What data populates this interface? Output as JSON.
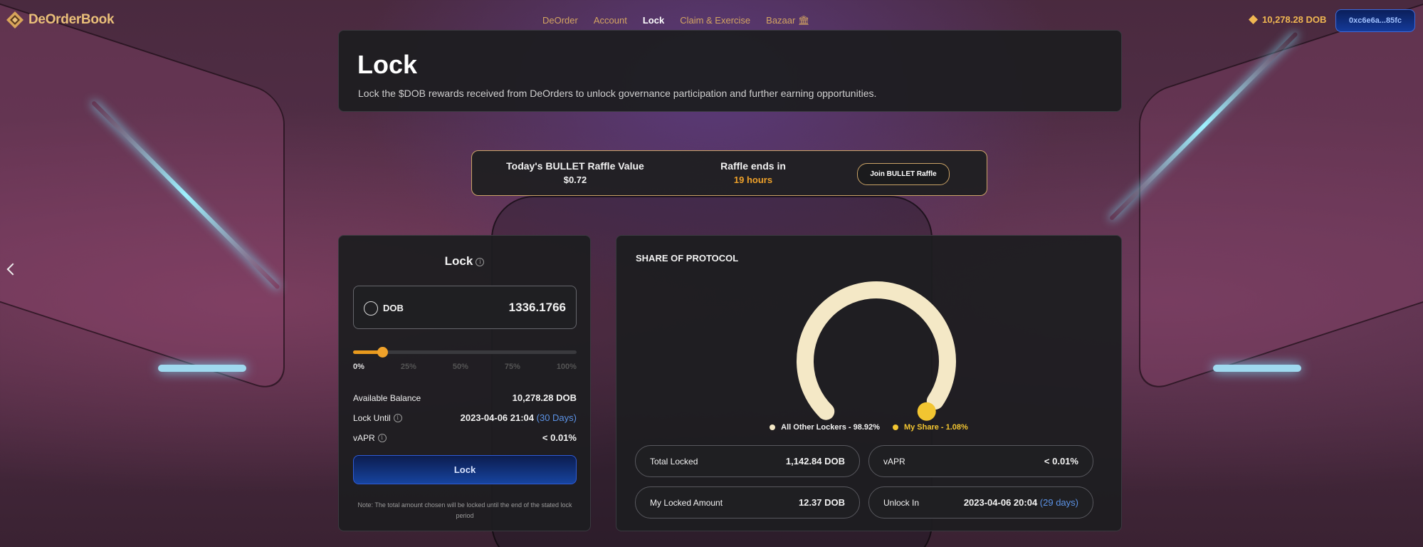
{
  "brand": {
    "name": "DeOrderBook"
  },
  "nav": {
    "items": [
      {
        "label": "DeOrder",
        "active": false
      },
      {
        "label": "Account",
        "active": false
      },
      {
        "label": "Lock",
        "active": true
      },
      {
        "label": "Claim & Exercise",
        "active": false
      },
      {
        "label": "Bazaar 🏛",
        "active": false
      }
    ]
  },
  "wallet": {
    "balance": "10,278.28 DOB",
    "address": "0xc6e6a...85fc"
  },
  "hero": {
    "title": "Lock",
    "subtitle": "Lock the $DOB rewards received from DeOrders to unlock governance participation and further earning opportunities."
  },
  "raffle": {
    "value_label": "Today's BULLET Raffle Value",
    "value": "$0.72",
    "ends_label": "Raffle ends in",
    "ends_value": "19 hours",
    "button": "Join BULLET Raffle"
  },
  "lock": {
    "title": "Lock",
    "token": "DOB",
    "amount": "1336.1766",
    "slider_percent": 13,
    "ticks": [
      "0%",
      "25%",
      "50%",
      "75%",
      "100%"
    ],
    "available_label": "Available Balance",
    "available_value": "10,278.28 DOB",
    "until_label": "Lock Until",
    "until_value": "2023-04-06 21:04",
    "until_days": "(30 Days)",
    "vapr_label": "vAPR",
    "vapr_value": "< 0.01%",
    "button": "Lock",
    "note": "Note: The total amount chosen will be locked until the end of the stated lock period"
  },
  "share": {
    "title": "SHARE OF PROTOCOL",
    "legend_other": "All Other Lockers - 98.92%",
    "legend_mine": "My Share - 1.08%",
    "other_pct": 98.92,
    "my_pct": 1.08,
    "colors": {
      "other": "#f4e8c6",
      "mine": "#f2c531"
    },
    "total_locked_label": "Total Locked",
    "total_locked_value": "1,142.84 DOB",
    "vapr_label": "vAPR",
    "vapr_value": "< 0.01%",
    "my_locked_label": "My Locked Amount",
    "my_locked_value": "12.37 DOB",
    "unlock_label": "Unlock In",
    "unlock_value": "2023-04-06 20:04",
    "unlock_days": "(29 days)"
  }
}
